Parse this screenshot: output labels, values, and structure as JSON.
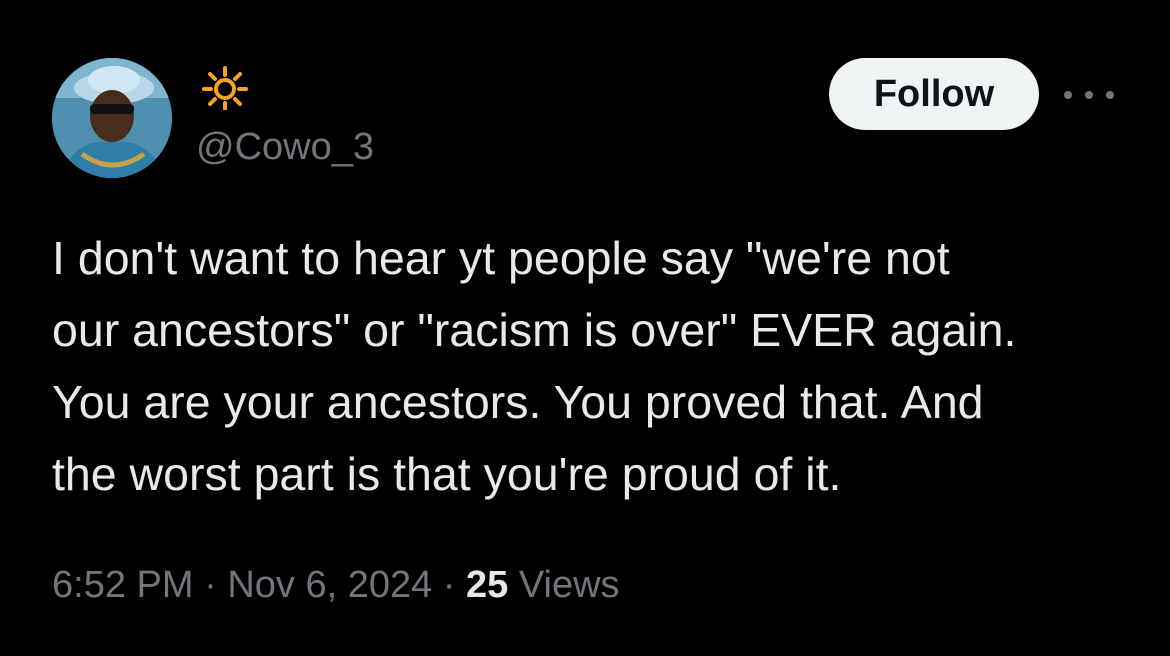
{
  "user": {
    "display_name_icon": "sun-icon",
    "handle": "@Cowo_3",
    "avatar": "avatar-photo"
  },
  "actions": {
    "follow_label": "Follow",
    "more_icon": "more-horizontal-icon"
  },
  "tweet": {
    "text": "I don't want to hear yt people say \"we're not\nour ancestors\" or \"racism is over\" EVER again.\nYou are your ancestors. You proved that. And\nthe worst part is that you're proud of it."
  },
  "meta": {
    "time": "6:52 PM",
    "separator": " · ",
    "date": "Nov 6, 2024",
    "views_count": "25",
    "views_label": " Views"
  },
  "colors": {
    "background": "#000000",
    "text_primary": "#e7e9ea",
    "text_secondary": "#71767b",
    "follow_bg": "#eff3f4",
    "follow_text": "#0f1419",
    "sun": "#f7a41d"
  }
}
